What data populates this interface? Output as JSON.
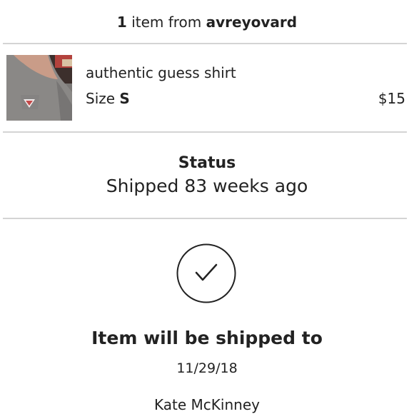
{
  "header": {
    "count": "1",
    "from_text": "item from",
    "seller": "avreyovard"
  },
  "item": {
    "title": "authentic guess shirt",
    "size_label": "Size",
    "size_value": "S",
    "price": "$15",
    "thumbnail_icon": "guess-shirt-photo"
  },
  "status": {
    "title": "Status",
    "text": "Shipped 83 weeks ago"
  },
  "shipping": {
    "icon": "checkmark-circle-icon",
    "title": "Item will be shipped to",
    "date": "11/29/18",
    "name": "Kate McKinney"
  },
  "colors": {
    "text": "#222222",
    "divider": "#d4d4d4",
    "background": "#ffffff"
  }
}
